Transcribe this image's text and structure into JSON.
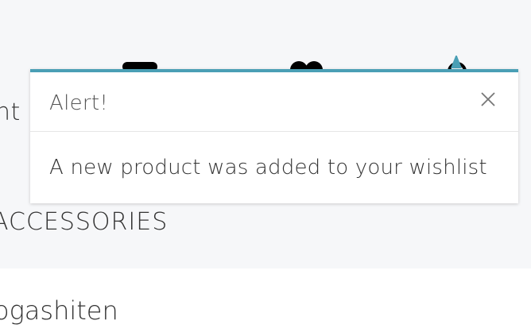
{
  "background": {
    "side_text": "nt",
    "category_heading": "ACCESSORIES",
    "vendor_name": "ogashiten"
  },
  "header_icons": {
    "account_icon": "account-icon",
    "wishlist_icon": "heart-icon",
    "cart_icon": "cart-icon"
  },
  "alert": {
    "title": "Alert!",
    "message": "A new product was added to your wishlist",
    "close_icon": "close-icon",
    "accent_color": "#4a9fb5"
  }
}
